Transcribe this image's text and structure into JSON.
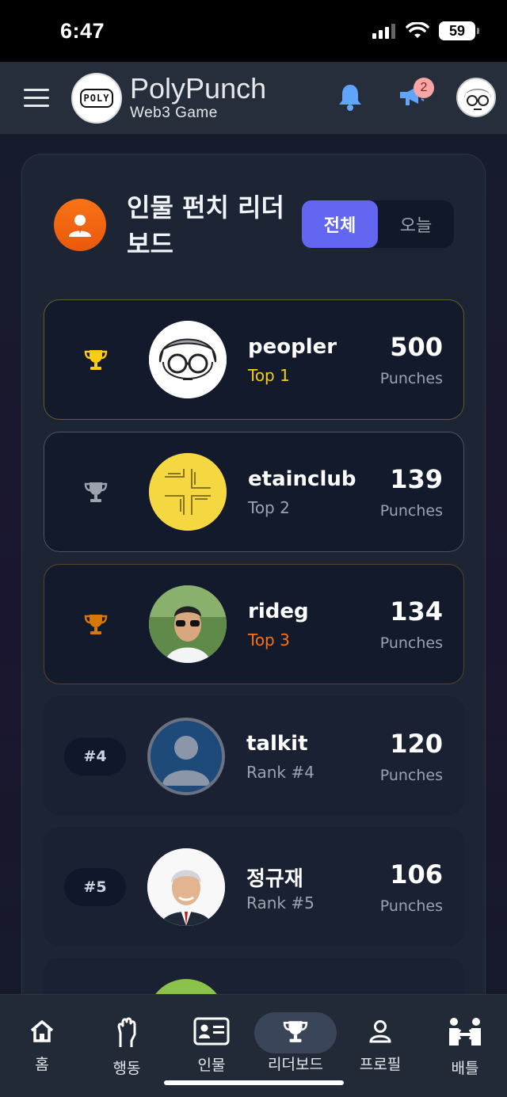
{
  "status_bar": {
    "time": "6:47",
    "battery": "59"
  },
  "header": {
    "logo_text": "POLY",
    "title": "PolyPunch",
    "subtitle": "Web3 Game",
    "notification_badge": "2"
  },
  "leaderboard": {
    "title": "인물 펀치 리더보드",
    "toggle": {
      "all_label": "전체",
      "today_label": "오늘",
      "selected": "전체"
    },
    "entries": [
      {
        "name": "peopler",
        "sub": "Top 1",
        "score": "500",
        "unit": "Punches",
        "tier": "gold"
      },
      {
        "name": "etainclub",
        "sub": "Top 2",
        "score": "139",
        "unit": "Punches",
        "tier": "silver"
      },
      {
        "name": "rideg",
        "sub": "Top 3",
        "score": "134",
        "unit": "Punches",
        "tier": "bronze"
      },
      {
        "rank_label": "#4",
        "name": "talkit",
        "sub": "Rank #4",
        "score": "120",
        "unit": "Punches"
      },
      {
        "rank_label": "#5",
        "name": "정규재",
        "sub": "Rank #5",
        "score": "106",
        "unit": "Punches"
      }
    ]
  },
  "bottom_nav": {
    "items": [
      {
        "label": "홈",
        "icon": "home-icon"
      },
      {
        "label": "행동",
        "icon": "fist-icon"
      },
      {
        "label": "인물",
        "icon": "id-card-icon"
      },
      {
        "label": "리더보드",
        "icon": "trophy-icon",
        "active": true
      },
      {
        "label": "프로필",
        "icon": "person-icon"
      },
      {
        "label": "배틀",
        "icon": "battle-icon"
      }
    ]
  },
  "colors": {
    "accent": "#6366f1",
    "gold": "#facc15",
    "silver": "#9ca3af",
    "bronze": "#f97316",
    "panel_icon": "#f97316"
  }
}
